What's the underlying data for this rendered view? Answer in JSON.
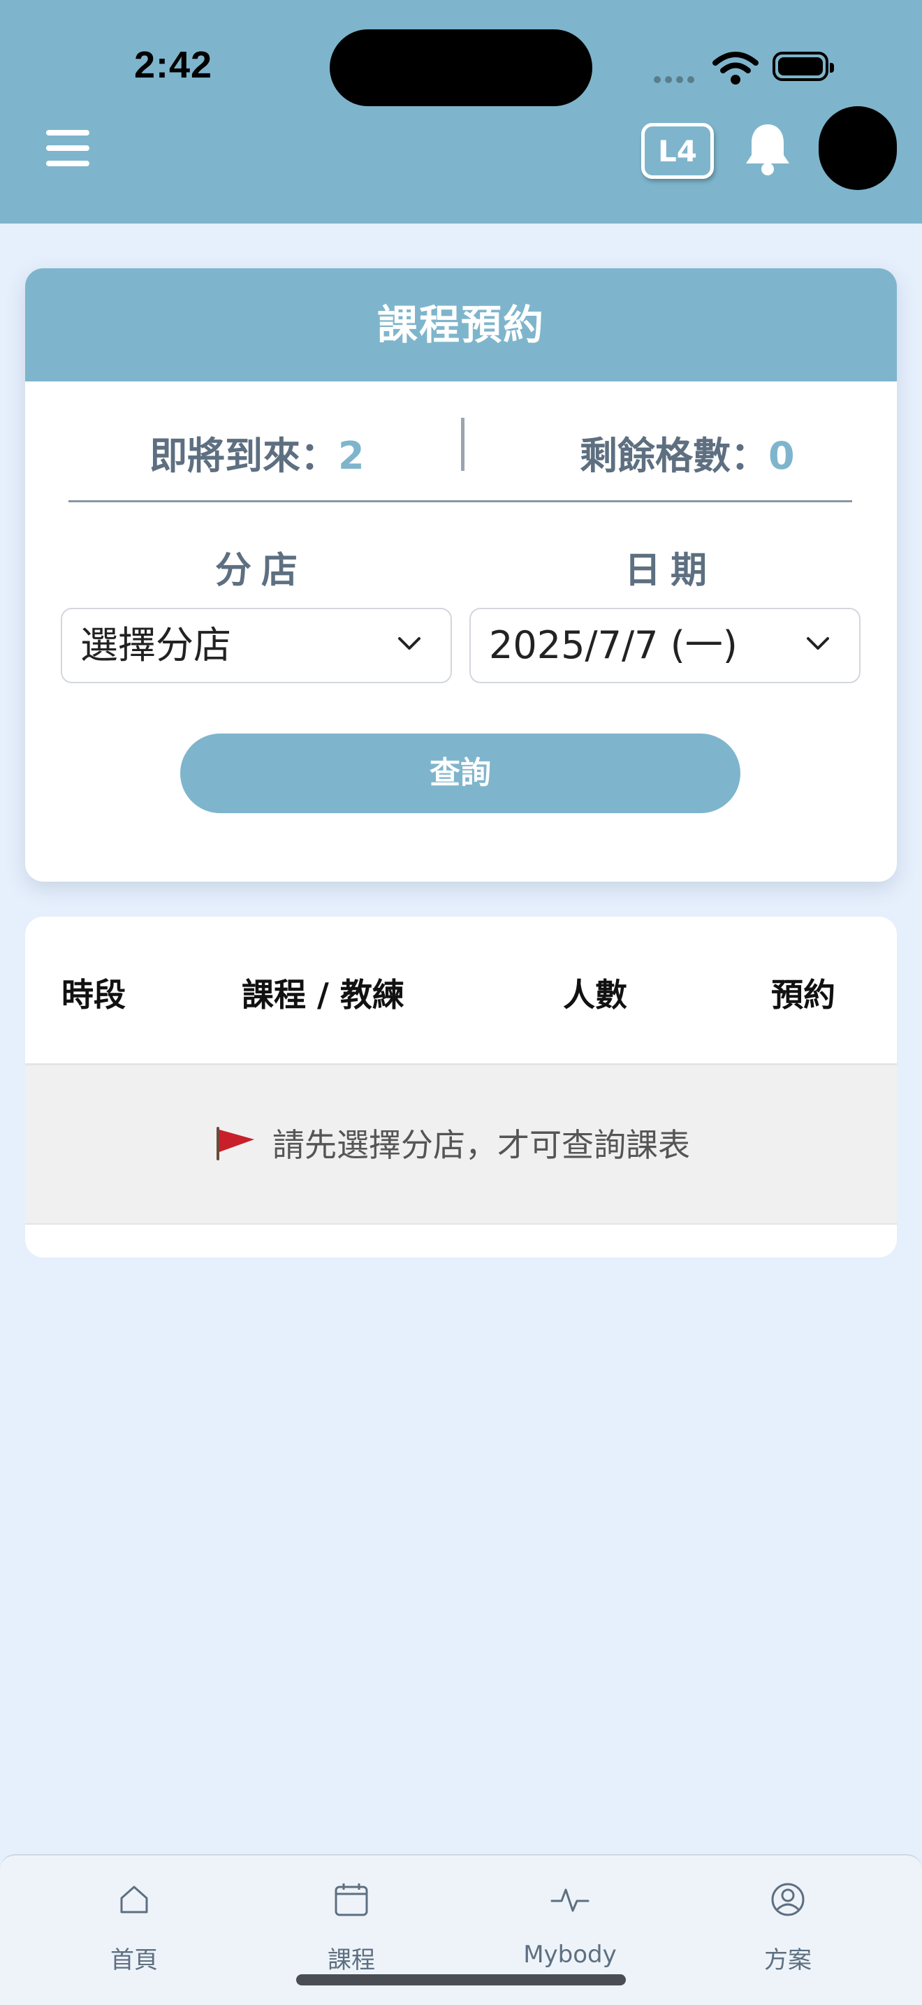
{
  "status_bar": {
    "time": "2:42"
  },
  "header": {
    "level_badge": "L4"
  },
  "booking": {
    "title": "課程預約",
    "upcoming_label": "即將到來：",
    "upcoming_value": "2",
    "remaining_label": "剩餘格數：",
    "remaining_value": "0",
    "branch_label": "分店",
    "date_label": "日期",
    "branch_select": "選擇分店",
    "date_select": "2025/7/7 (一)",
    "query_button": "查詢"
  },
  "schedule_table": {
    "columns": [
      "時段",
      "課程 / 教練",
      "人數",
      "預約"
    ],
    "empty_message": "請先選擇分店，才可查詢課表"
  },
  "tabbar": {
    "items": [
      {
        "label": "首頁",
        "icon": "home-icon"
      },
      {
        "label": "課程",
        "icon": "calendar-icon"
      },
      {
        "label": "Mybody",
        "icon": "activity-icon"
      },
      {
        "label": "方案",
        "icon": "user-circle-icon"
      }
    ]
  },
  "colors": {
    "header": "#7eb5cc",
    "background": "#e6effc",
    "accent": "#7eb5cc",
    "label_text": "#5d6f80"
  }
}
